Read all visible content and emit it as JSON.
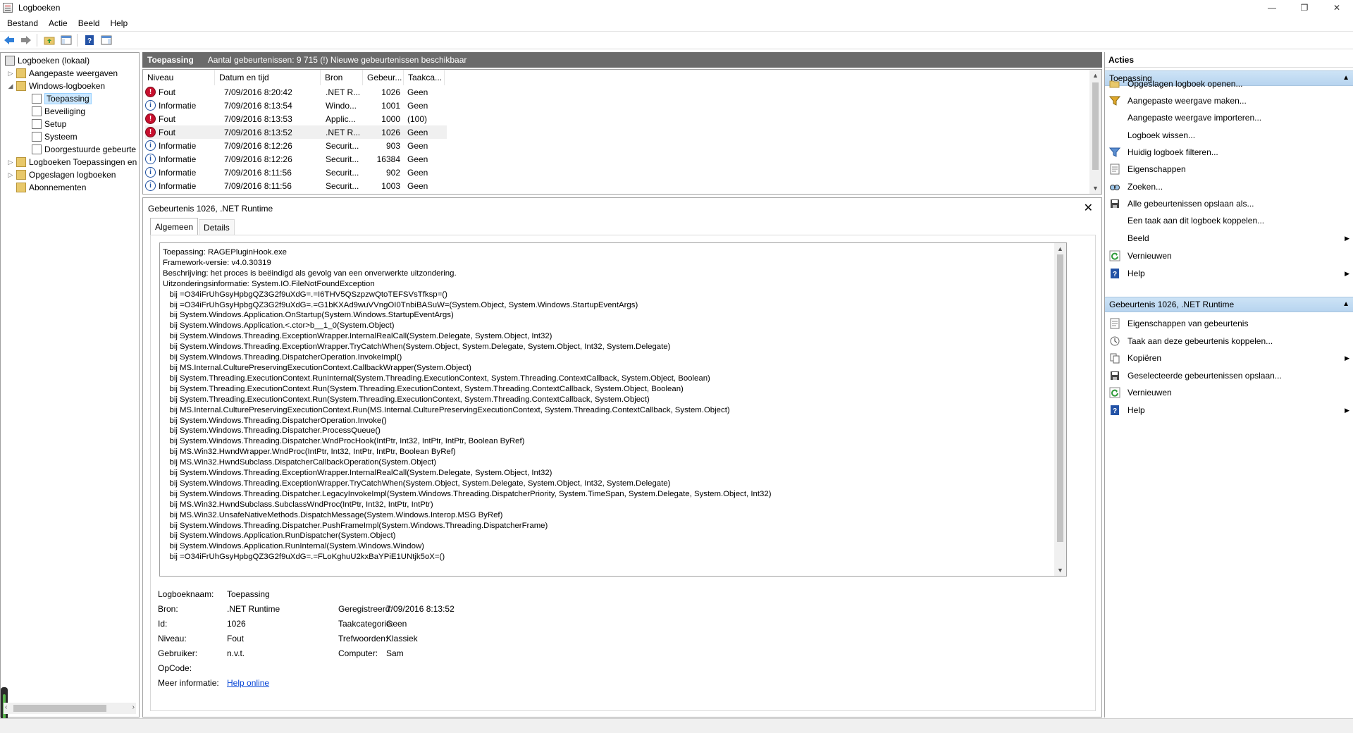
{
  "window": {
    "title": "Logboeken",
    "minimize": "—",
    "restore": "❐",
    "close": "✕"
  },
  "menu": [
    "Bestand",
    "Actie",
    "Beeld",
    "Help"
  ],
  "tree": {
    "root": "Logboeken (lokaal)",
    "custom_views": "Aangepaste weergaven",
    "windows_logs": "Windows-logboeken",
    "application": "Toepassing",
    "security": "Beveiliging",
    "setup": "Setup",
    "system": "Systeem",
    "forwarded": "Doorgestuurde gebeurte",
    "apps_services": "Logboeken Toepassingen en",
    "saved_logs": "Opgeslagen logboeken",
    "subscriptions": "Abonnementen"
  },
  "center": {
    "title": "Toepassing",
    "info": "Aantal gebeurtenissen: 9 715 (!) Nieuwe gebeurtenissen beschikbaar"
  },
  "events": {
    "columns": [
      "Niveau",
      "Datum en tijd",
      "Bron",
      "Gebeur...",
      "Taakca..."
    ],
    "rows": [
      {
        "level": "Fout",
        "type": "error",
        "datetime": "7/09/2016 8:20:42",
        "source": ".NET R...",
        "id": "1026",
        "task": "Geen"
      },
      {
        "level": "Informatie",
        "type": "info",
        "datetime": "7/09/2016 8:13:54",
        "source": "Windo...",
        "id": "1001",
        "task": "Geen"
      },
      {
        "level": "Fout",
        "type": "error",
        "datetime": "7/09/2016 8:13:53",
        "source": "Applic...",
        "id": "1000",
        "task": "(100)"
      },
      {
        "level": "Fout",
        "type": "error",
        "datetime": "7/09/2016 8:13:52",
        "source": ".NET R...",
        "id": "1026",
        "task": "Geen"
      },
      {
        "level": "Informatie",
        "type": "info",
        "datetime": "7/09/2016 8:12:26",
        "source": "Securit...",
        "id": "903",
        "task": "Geen"
      },
      {
        "level": "Informatie",
        "type": "info",
        "datetime": "7/09/2016 8:12:26",
        "source": "Securit...",
        "id": "16384",
        "task": "Geen"
      },
      {
        "level": "Informatie",
        "type": "info",
        "datetime": "7/09/2016 8:11:56",
        "source": "Securit...",
        "id": "902",
        "task": "Geen"
      },
      {
        "level": "Informatie",
        "type": "info",
        "datetime": "7/09/2016 8:11:56",
        "source": "Securit...",
        "id": "1003",
        "task": "Geen"
      }
    ]
  },
  "detail": {
    "title": "Gebeurtenis 1026, .NET Runtime",
    "tab_general": "Algemeen",
    "tab_details": "Details",
    "description": [
      "Toepassing: RAGEPluginHook.exe",
      "Framework-versie: v4.0.30319",
      "Beschrijving: het proces is beëindigd als gevolg van een onverwerkte uitzondering.",
      "Uitzonderingsinformatie: System.IO.FileNotFoundException",
      "   bij =O34iFrUhGsyHpbgQZ3G2f9uXdG=.=I6THV5QSzpzwQtoTEFSVsTfksp=()",
      "   bij =O34iFrUhGsyHpbgQZ3G2f9uXdG=.=G1bKXAd9wuVVngOI0TnbiBASuW=(System.Object, System.Windows.StartupEventArgs)",
      "   bij System.Windows.Application.OnStartup(System.Windows.StartupEventArgs)",
      "   bij System.Windows.Application.<.ctor>b__1_0(System.Object)",
      "   bij System.Windows.Threading.ExceptionWrapper.InternalRealCall(System.Delegate, System.Object, Int32)",
      "   bij System.Windows.Threading.ExceptionWrapper.TryCatchWhen(System.Object, System.Delegate, System.Object, Int32, System.Delegate)",
      "   bij System.Windows.Threading.DispatcherOperation.InvokeImpl()",
      "   bij MS.Internal.CulturePreservingExecutionContext.CallbackWrapper(System.Object)",
      "   bij System.Threading.ExecutionContext.RunInternal(System.Threading.ExecutionContext, System.Threading.ContextCallback, System.Object, Boolean)",
      "   bij System.Threading.ExecutionContext.Run(System.Threading.ExecutionContext, System.Threading.ContextCallback, System.Object, Boolean)",
      "   bij System.Threading.ExecutionContext.Run(System.Threading.ExecutionContext, System.Threading.ContextCallback, System.Object)",
      "   bij MS.Internal.CulturePreservingExecutionContext.Run(MS.Internal.CulturePreservingExecutionContext, System.Threading.ContextCallback, System.Object)",
      "   bij System.Windows.Threading.DispatcherOperation.Invoke()",
      "   bij System.Windows.Threading.Dispatcher.ProcessQueue()",
      "   bij System.Windows.Threading.Dispatcher.WndProcHook(IntPtr, Int32, IntPtr, IntPtr, Boolean ByRef)",
      "   bij MS.Win32.HwndWrapper.WndProc(IntPtr, Int32, IntPtr, IntPtr, Boolean ByRef)",
      "   bij MS.Win32.HwndSubclass.DispatcherCallbackOperation(System.Object)",
      "   bij System.Windows.Threading.ExceptionWrapper.InternalRealCall(System.Delegate, System.Object, Int32)",
      "   bij System.Windows.Threading.ExceptionWrapper.TryCatchWhen(System.Object, System.Delegate, System.Object, Int32, System.Delegate)",
      "   bij System.Windows.Threading.Dispatcher.LegacyInvokeImpl(System.Windows.Threading.DispatcherPriority, System.TimeSpan, System.Delegate, System.Object, Int32)",
      "   bij MS.Win32.HwndSubclass.SubclassWndProc(IntPtr, Int32, IntPtr, IntPtr)",
      "   bij MS.Win32.UnsafeNativeMethods.DispatchMessage(System.Windows.Interop.MSG ByRef)",
      "   bij System.Windows.Threading.Dispatcher.PushFrameImpl(System.Windows.Threading.DispatcherFrame)",
      "   bij System.Windows.Application.RunDispatcher(System.Object)",
      "   bij System.Windows.Application.RunInternal(System.Windows.Window)",
      "   bij =O34iFrUhGsyHpbgQZ3G2f9uXdG=.=FLoKghuU2kxBaYPiE1UNtjk5oX=()"
    ],
    "props": {
      "log_name_k": "Logboeknaam:",
      "log_name_v": "Toepassing",
      "source_k": "Bron:",
      "source_v": ".NET Runtime",
      "id_k": "Id:",
      "id_v": "1026",
      "level_k": "Niveau:",
      "level_v": "Fout",
      "user_k": "Gebruiker:",
      "user_v": "n.v.t.",
      "opcode_k": "OpCode:",
      "more_k": "Meer informatie:",
      "more_v": "Help online",
      "logged_k": "Geregistreerd:",
      "logged_v": "7/09/2016 8:13:52",
      "task_k": "Taakcategorie:",
      "task_v": "Geen",
      "keywords_k": "Trefwoorden:",
      "keywords_v": "Klassiek",
      "computer_k": "Computer:",
      "computer_v": "Sam"
    }
  },
  "actions": {
    "title": "Acties",
    "section1": "Toepassing",
    "items1": [
      "Opgeslagen logboek openen...",
      "Aangepaste weergave maken...",
      "Aangepaste weergave importeren...",
      "Logboek wissen...",
      "Huidig logboek filteren...",
      "Eigenschappen",
      "Zoeken...",
      "Alle gebeurtenissen opslaan als...",
      "Een taak aan dit logboek koppelen...",
      "Beeld",
      "Vernieuwen",
      "Help"
    ],
    "section2": "Gebeurtenis 1026, .NET Runtime",
    "items2": [
      "Eigenschappen van gebeurtenis",
      "Taak aan deze gebeurtenis koppelen...",
      "Kopiëren",
      "Geselecteerde gebeurtenissen opslaan...",
      "Vernieuwen",
      "Help"
    ]
  }
}
